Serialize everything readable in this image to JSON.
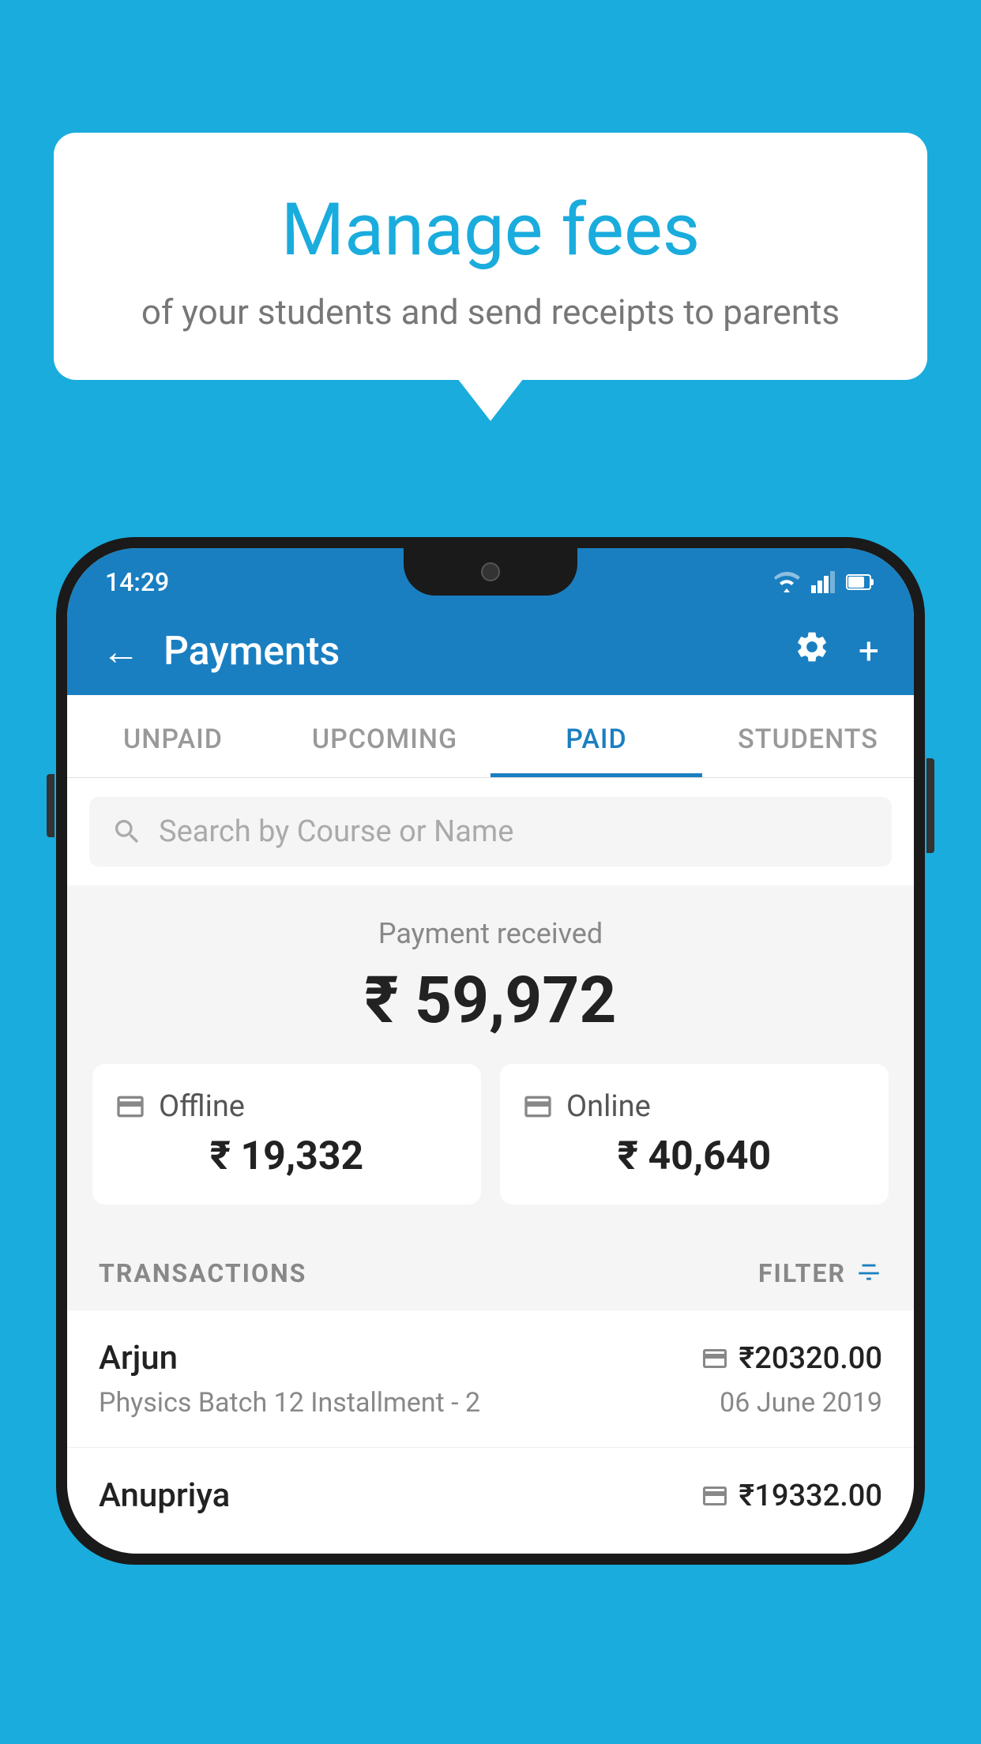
{
  "background_color": "#1AACDD",
  "speech_bubble": {
    "title": "Manage fees",
    "subtitle": "of your students and send receipts to parents"
  },
  "status_bar": {
    "time": "14:29",
    "icons": [
      "wifi",
      "signal",
      "battery"
    ]
  },
  "header": {
    "title": "Payments",
    "back_label": "←",
    "settings_label": "⚙",
    "add_label": "+"
  },
  "tabs": [
    {
      "label": "UNPAID",
      "active": false
    },
    {
      "label": "UPCOMING",
      "active": false
    },
    {
      "label": "PAID",
      "active": true
    },
    {
      "label": "STUDENTS",
      "active": false
    }
  ],
  "search": {
    "placeholder": "Search by Course or Name"
  },
  "payment_summary": {
    "label": "Payment received",
    "total": "₹ 59,972",
    "offline_label": "Offline",
    "offline_amount": "₹ 19,332",
    "online_label": "Online",
    "online_amount": "₹ 40,640"
  },
  "transactions_section": {
    "label": "TRANSACTIONS",
    "filter_label": "FILTER"
  },
  "transactions": [
    {
      "name": "Arjun",
      "description": "Physics Batch 12 Installment - 2",
      "amount": "₹20320.00",
      "date": "06 June 2019",
      "icon": "card"
    },
    {
      "name": "Anupriya",
      "description": "",
      "amount": "₹19332.00",
      "date": "",
      "icon": "cash"
    }
  ]
}
